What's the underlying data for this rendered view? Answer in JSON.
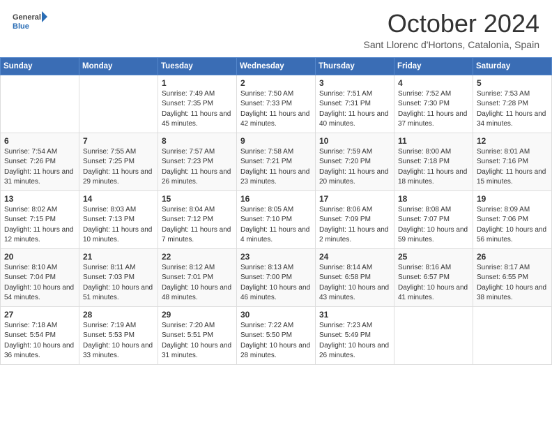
{
  "header": {
    "logo_line1": "General",
    "logo_line2": "Blue",
    "month_title": "October 2024",
    "subtitle": "Sant Llorenc d'Hortons, Catalonia, Spain"
  },
  "days_of_week": [
    "Sunday",
    "Monday",
    "Tuesday",
    "Wednesday",
    "Thursday",
    "Friday",
    "Saturday"
  ],
  "weeks": [
    [
      {
        "day": "",
        "info": ""
      },
      {
        "day": "",
        "info": ""
      },
      {
        "day": "1",
        "info": "Sunrise: 7:49 AM\nSunset: 7:35 PM\nDaylight: 11 hours and 45 minutes."
      },
      {
        "day": "2",
        "info": "Sunrise: 7:50 AM\nSunset: 7:33 PM\nDaylight: 11 hours and 42 minutes."
      },
      {
        "day": "3",
        "info": "Sunrise: 7:51 AM\nSunset: 7:31 PM\nDaylight: 11 hours and 40 minutes."
      },
      {
        "day": "4",
        "info": "Sunrise: 7:52 AM\nSunset: 7:30 PM\nDaylight: 11 hours and 37 minutes."
      },
      {
        "day": "5",
        "info": "Sunrise: 7:53 AM\nSunset: 7:28 PM\nDaylight: 11 hours and 34 minutes."
      }
    ],
    [
      {
        "day": "6",
        "info": "Sunrise: 7:54 AM\nSunset: 7:26 PM\nDaylight: 11 hours and 31 minutes."
      },
      {
        "day": "7",
        "info": "Sunrise: 7:55 AM\nSunset: 7:25 PM\nDaylight: 11 hours and 29 minutes."
      },
      {
        "day": "8",
        "info": "Sunrise: 7:57 AM\nSunset: 7:23 PM\nDaylight: 11 hours and 26 minutes."
      },
      {
        "day": "9",
        "info": "Sunrise: 7:58 AM\nSunset: 7:21 PM\nDaylight: 11 hours and 23 minutes."
      },
      {
        "day": "10",
        "info": "Sunrise: 7:59 AM\nSunset: 7:20 PM\nDaylight: 11 hours and 20 minutes."
      },
      {
        "day": "11",
        "info": "Sunrise: 8:00 AM\nSunset: 7:18 PM\nDaylight: 11 hours and 18 minutes."
      },
      {
        "day": "12",
        "info": "Sunrise: 8:01 AM\nSunset: 7:16 PM\nDaylight: 11 hours and 15 minutes."
      }
    ],
    [
      {
        "day": "13",
        "info": "Sunrise: 8:02 AM\nSunset: 7:15 PM\nDaylight: 11 hours and 12 minutes."
      },
      {
        "day": "14",
        "info": "Sunrise: 8:03 AM\nSunset: 7:13 PM\nDaylight: 11 hours and 10 minutes."
      },
      {
        "day": "15",
        "info": "Sunrise: 8:04 AM\nSunset: 7:12 PM\nDaylight: 11 hours and 7 minutes."
      },
      {
        "day": "16",
        "info": "Sunrise: 8:05 AM\nSunset: 7:10 PM\nDaylight: 11 hours and 4 minutes."
      },
      {
        "day": "17",
        "info": "Sunrise: 8:06 AM\nSunset: 7:09 PM\nDaylight: 11 hours and 2 minutes."
      },
      {
        "day": "18",
        "info": "Sunrise: 8:08 AM\nSunset: 7:07 PM\nDaylight: 10 hours and 59 minutes."
      },
      {
        "day": "19",
        "info": "Sunrise: 8:09 AM\nSunset: 7:06 PM\nDaylight: 10 hours and 56 minutes."
      }
    ],
    [
      {
        "day": "20",
        "info": "Sunrise: 8:10 AM\nSunset: 7:04 PM\nDaylight: 10 hours and 54 minutes."
      },
      {
        "day": "21",
        "info": "Sunrise: 8:11 AM\nSunset: 7:03 PM\nDaylight: 10 hours and 51 minutes."
      },
      {
        "day": "22",
        "info": "Sunrise: 8:12 AM\nSunset: 7:01 PM\nDaylight: 10 hours and 48 minutes."
      },
      {
        "day": "23",
        "info": "Sunrise: 8:13 AM\nSunset: 7:00 PM\nDaylight: 10 hours and 46 minutes."
      },
      {
        "day": "24",
        "info": "Sunrise: 8:14 AM\nSunset: 6:58 PM\nDaylight: 10 hours and 43 minutes."
      },
      {
        "day": "25",
        "info": "Sunrise: 8:16 AM\nSunset: 6:57 PM\nDaylight: 10 hours and 41 minutes."
      },
      {
        "day": "26",
        "info": "Sunrise: 8:17 AM\nSunset: 6:55 PM\nDaylight: 10 hours and 38 minutes."
      }
    ],
    [
      {
        "day": "27",
        "info": "Sunrise: 7:18 AM\nSunset: 5:54 PM\nDaylight: 10 hours and 36 minutes."
      },
      {
        "day": "28",
        "info": "Sunrise: 7:19 AM\nSunset: 5:53 PM\nDaylight: 10 hours and 33 minutes."
      },
      {
        "day": "29",
        "info": "Sunrise: 7:20 AM\nSunset: 5:51 PM\nDaylight: 10 hours and 31 minutes."
      },
      {
        "day": "30",
        "info": "Sunrise: 7:22 AM\nSunset: 5:50 PM\nDaylight: 10 hours and 28 minutes."
      },
      {
        "day": "31",
        "info": "Sunrise: 7:23 AM\nSunset: 5:49 PM\nDaylight: 10 hours and 26 minutes."
      },
      {
        "day": "",
        "info": ""
      },
      {
        "day": "",
        "info": ""
      }
    ]
  ]
}
